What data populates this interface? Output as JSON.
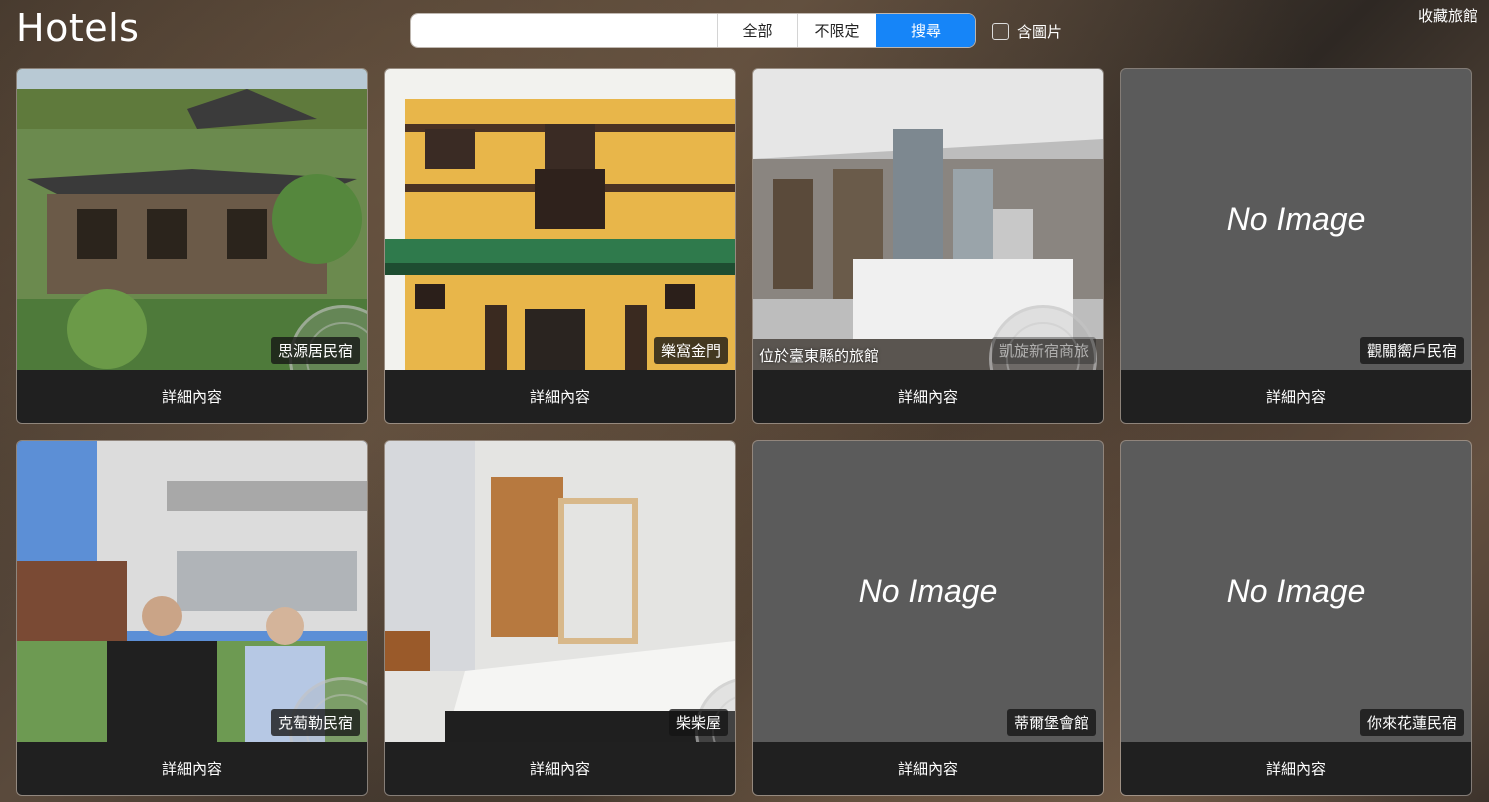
{
  "header": {
    "title": "Hotels",
    "search": {
      "value": "",
      "placeholder": ""
    },
    "filter_buttons": {
      "all": "全部",
      "any": "不限定",
      "search": "搜尋"
    },
    "image_filter_label": "含圖片",
    "image_filter_checked": false,
    "favorites_label": "收藏旅館"
  },
  "theme": {
    "accent": "#1685f8",
    "card_placeholder": "#5b5b5b",
    "detail_bar": "#1c1c1c"
  },
  "hotels": [
    {
      "name": "思源居民宿",
      "has_image": true,
      "detail_label": "詳細內容"
    },
    {
      "name": "樂窩金門",
      "has_image": true,
      "detail_label": "詳細內容"
    },
    {
      "name": "凱旋新宿商旅",
      "caption": "位於臺東縣的旅館",
      "has_image": true,
      "detail_label": "詳細內容"
    },
    {
      "name": "觀關嚮戶民宿",
      "has_image": false,
      "no_image_text": "No Image",
      "detail_label": "詳細內容"
    },
    {
      "name": "克萄勒民宿",
      "has_image": true,
      "detail_label": "詳細內容"
    },
    {
      "name": "柴柴屋",
      "has_image": true,
      "detail_label": "詳細內容"
    },
    {
      "name": "蒂爾堡會館",
      "has_image": false,
      "no_image_text": "No Image",
      "detail_label": "詳細內容"
    },
    {
      "name": "你來花蓮民宿",
      "has_image": false,
      "no_image_text": "No Image",
      "detail_label": "詳細內容"
    }
  ]
}
